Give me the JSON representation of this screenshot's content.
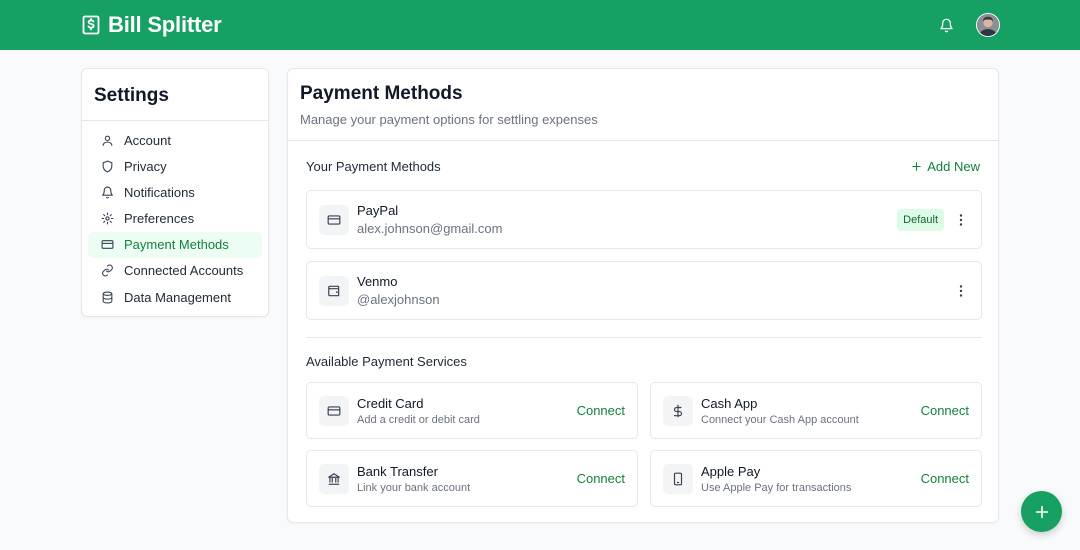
{
  "app": {
    "title": "Bill Splitter"
  },
  "colors": {
    "brand": "#16a063",
    "accent": "#15803d",
    "active_bg": "#ecfdf3"
  },
  "sidebar": {
    "title": "Settings",
    "items": [
      {
        "label": "Account",
        "icon": "user-icon",
        "active": false
      },
      {
        "label": "Privacy",
        "icon": "shield-icon",
        "active": false
      },
      {
        "label": "Notifications",
        "icon": "bell-icon",
        "active": false
      },
      {
        "label": "Preferences",
        "icon": "gear-icon",
        "active": false
      },
      {
        "label": "Payment Methods",
        "icon": "credit-card-icon",
        "active": true
      },
      {
        "label": "Connected Accounts",
        "icon": "link-icon",
        "active": false
      },
      {
        "label": "Data Management",
        "icon": "database-icon",
        "active": false
      }
    ]
  },
  "main": {
    "title": "Payment Methods",
    "subtitle": "Manage your payment options for settling expenses",
    "your_methods": {
      "title": "Your Payment Methods",
      "add_label": "Add New",
      "items": [
        {
          "name": "PayPal",
          "detail": "alex.johnson@gmail.com",
          "badge": "Default",
          "icon": "credit-card-icon"
        },
        {
          "name": "Venmo",
          "detail": "@alexjohnson",
          "badge": "",
          "icon": "wallet-icon"
        }
      ]
    },
    "services": {
      "title": "Available Payment Services",
      "items": [
        {
          "name": "Credit Card",
          "detail": "Add a credit or debit card",
          "action": "Connect",
          "icon": "credit-card-icon"
        },
        {
          "name": "Cash App",
          "detail": "Connect your Cash App account",
          "action": "Connect",
          "icon": "dollar-icon"
        },
        {
          "name": "Bank Transfer",
          "detail": "Link your bank account",
          "action": "Connect",
          "icon": "bank-icon"
        },
        {
          "name": "Apple Pay",
          "detail": "Use Apple Pay for transactions",
          "action": "Connect",
          "icon": "phone-icon"
        }
      ]
    }
  }
}
